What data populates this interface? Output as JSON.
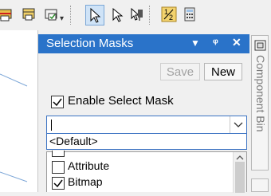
{
  "toolbar": {
    "icons": [
      "print-icon",
      "print-preview-icon",
      "print-setup-icon",
      "select-icon",
      "select-add-icon",
      "select-cursor-icon",
      "fraction-icon",
      "calculator-icon"
    ],
    "fraction_text": "1/2"
  },
  "panel": {
    "title": "Selection Masks",
    "menu_glyph": "▼",
    "pin_glyph": "ᵠ",
    "close_glyph": "✕",
    "save_label": "Save",
    "new_label": "New",
    "enable_label": "Enable Select Mask",
    "enable_checked": true,
    "mask_input_value": "",
    "dropdown_option": "<Default>",
    "list_items": [
      {
        "label": "Attribute",
        "checked": false
      },
      {
        "label": "Bitmap",
        "checked": true
      }
    ]
  },
  "dock": {
    "tab_label": "Component Bin"
  }
}
